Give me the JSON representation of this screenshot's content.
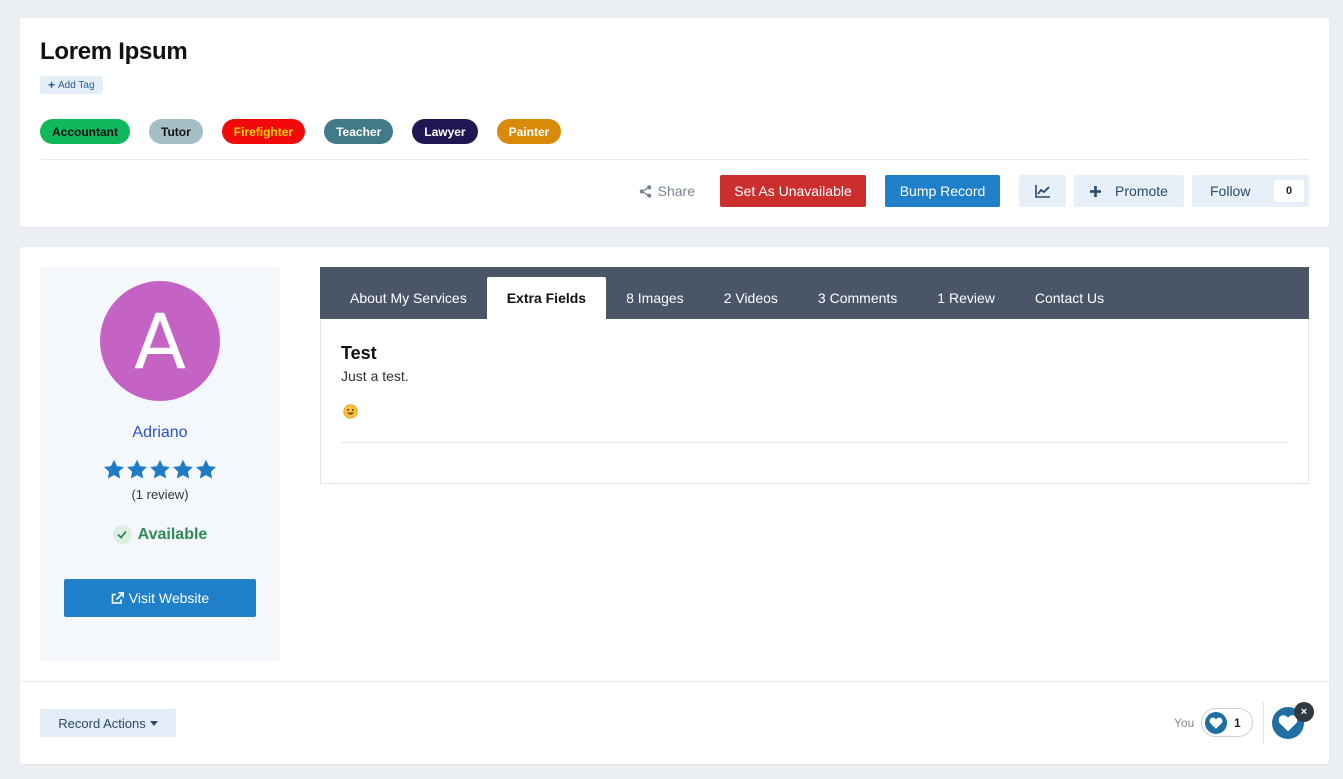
{
  "header": {
    "title": "Lorem Ipsum",
    "add_tag_label": "Add Tag",
    "tags": [
      {
        "label": "Accountant",
        "bg": "#0fb85a",
        "color": "#111111"
      },
      {
        "label": "Tutor",
        "bg": "#a6bfc7",
        "color": "#111111"
      },
      {
        "label": "Firefighter",
        "bg": "#f20a0a",
        "color": "#ffd400"
      },
      {
        "label": "Teacher",
        "bg": "#427a8a",
        "color": "#ffffff"
      },
      {
        "label": "Lawyer",
        "bg": "#211653",
        "color": "#ffffff"
      },
      {
        "label": "Painter",
        "bg": "#d98a09",
        "color": "#ffffff"
      }
    ]
  },
  "actions": {
    "share_label": "Share",
    "unavailable_label": "Set As Unavailable",
    "bump_label": "Bump Record",
    "chart_icon": "chart-line-icon",
    "promote_label": "Promote",
    "follow_label": "Follow",
    "follow_count": "0"
  },
  "profile": {
    "avatar_letter": "A",
    "avatar_color": "#c463c4",
    "name": "Adriano",
    "rating": 5,
    "review_count": "(1 review)",
    "status": "Available",
    "visit_label": "Visit Website"
  },
  "tabs": [
    {
      "label": "About My Services",
      "active": false
    },
    {
      "label": "Extra Fields",
      "active": true
    },
    {
      "label": "8 Images",
      "active": false
    },
    {
      "label": "2 Videos",
      "active": false
    },
    {
      "label": "3 Comments",
      "active": false
    },
    {
      "label": "1 Review",
      "active": false
    },
    {
      "label": "Contact Us",
      "active": false
    }
  ],
  "content": {
    "field_title": "Test",
    "field_text": "Just a test.",
    "emoji_icon": "smiley-emoji-icon"
  },
  "footer": {
    "record_actions_label": "Record Actions",
    "you_label": "You",
    "reaction_count": "1",
    "close_symbol": "×"
  },
  "colors": {
    "accent_blue": "#1f80c9",
    "danger_red": "#cc2e2e",
    "success_green": "#2e8a51",
    "tab_bar": "#4a5568"
  }
}
